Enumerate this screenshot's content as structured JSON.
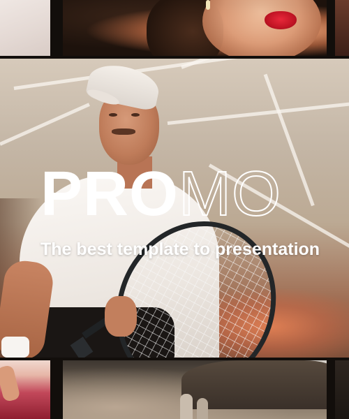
{
  "title": {
    "bold_part": "PRO",
    "outline_part": "MO"
  },
  "subtitle": "The best template to presentation",
  "colors": {
    "title_text": "#ffffff",
    "subtitle_text": "#ffffff",
    "background": "#120e0b",
    "lips_accent": "#c01424"
  }
}
